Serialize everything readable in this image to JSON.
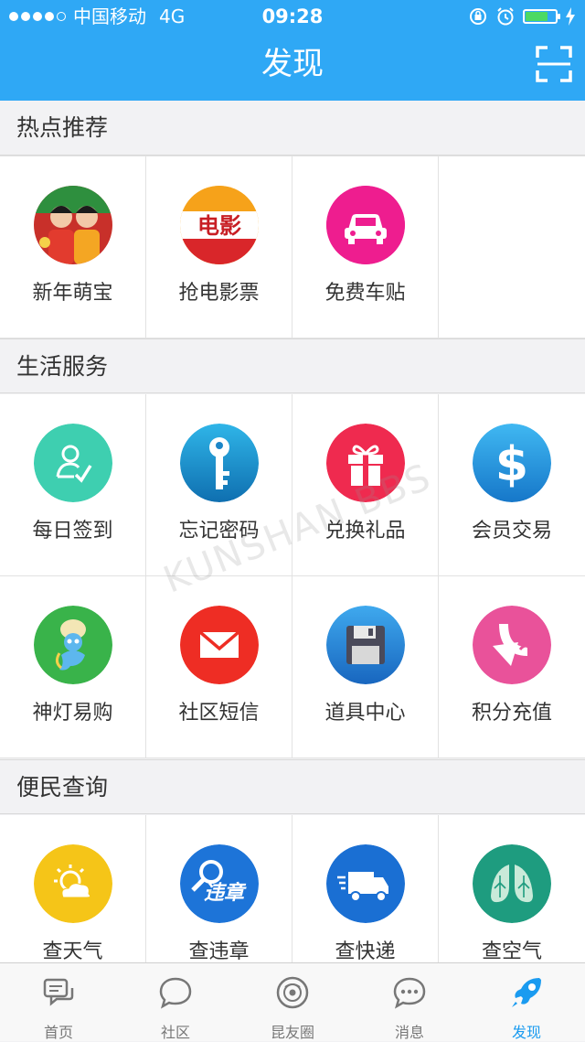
{
  "status_bar": {
    "carrier": "中国移动",
    "network": "4G",
    "time": "09:28",
    "signal_bars": 4,
    "signal_max": 5,
    "battery_level": 0.75
  },
  "header": {
    "title": "发现",
    "scan_icon": "scan-icon"
  },
  "sections": [
    {
      "title": "热点推荐",
      "items": [
        {
          "label": "新年萌宝",
          "icon": "new-year-baby-icon"
        },
        {
          "label": "抢电影票",
          "icon": "movie-ticket-icon",
          "icon_text": "电影"
        },
        {
          "label": "免费车贴",
          "icon": "car-icon"
        }
      ]
    },
    {
      "title": "生活服务",
      "items": [
        {
          "label": "每日签到",
          "icon": "checkin-icon"
        },
        {
          "label": "忘记密码",
          "icon": "key-icon"
        },
        {
          "label": "兑换礼品",
          "icon": "gift-icon"
        },
        {
          "label": "会员交易",
          "icon": "dollar-icon"
        },
        {
          "label": "神灯易购",
          "icon": "genie-icon"
        },
        {
          "label": "社区短信",
          "icon": "mail-icon"
        },
        {
          "label": "道具中心",
          "icon": "floppy-disk-icon"
        },
        {
          "label": "积分充值",
          "icon": "recharge-arrow-icon"
        }
      ]
    },
    {
      "title": "便民查询",
      "items": [
        {
          "label": "查天气",
          "icon": "weather-icon"
        },
        {
          "label": "查违章",
          "icon": "traffic-violation-icon",
          "icon_text": "违章"
        },
        {
          "label": "查快递",
          "icon": "delivery-truck-icon"
        },
        {
          "label": "查空气",
          "icon": "air-quality-lungs-icon"
        }
      ]
    }
  ],
  "watermark": "KUNSHAN BBS",
  "tabbar": [
    {
      "label": "首页",
      "icon": "home-chat-icon",
      "active": false
    },
    {
      "label": "社区",
      "icon": "community-bubble-icon",
      "active": false
    },
    {
      "label": "昆友圈",
      "icon": "friends-circle-icon",
      "active": false
    },
    {
      "label": "消息",
      "icon": "message-icon",
      "active": false
    },
    {
      "label": "发现",
      "icon": "rocket-icon",
      "active": true
    }
  ],
  "colors": {
    "header": "#2fa8f5",
    "active_tab": "#1a9bf0"
  }
}
